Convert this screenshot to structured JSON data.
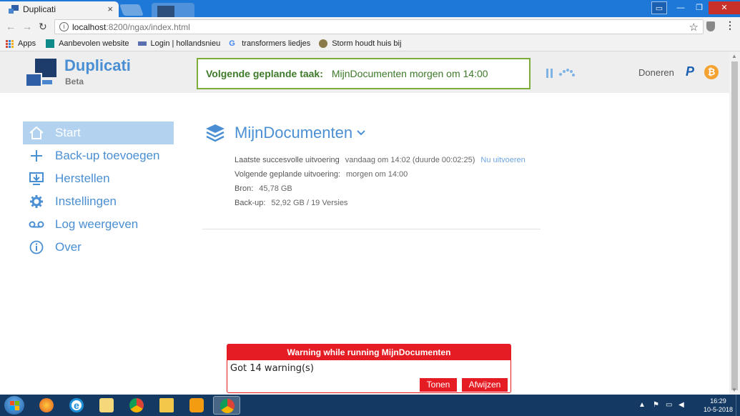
{
  "browser": {
    "tab_title": "Duplicati",
    "tab_close": "×",
    "url_host": "localhost",
    "url_rest": ":8200/ngax/index.html",
    "star": "☆",
    "menu": "⋮",
    "nav_back": "←",
    "nav_forward": "→",
    "reload": "↻",
    "window_controls": {
      "minimize": "—",
      "maximize": "❐",
      "close": "✕"
    }
  },
  "bookmarks": [
    {
      "label": "Apps",
      "icon": "apps-grid-icon"
    },
    {
      "label": "Aanbevolen website",
      "icon": "bing-icon",
      "color": "#0e8a8a"
    },
    {
      "label": "Login | hollandsnieu",
      "icon": "site-icon",
      "color": "#5a6fb0"
    },
    {
      "label": "transformers liedjes",
      "icon": "google-icon",
      "color": "#4285f4"
    },
    {
      "label": "Storm houdt huis bij",
      "icon": "gear-site-icon",
      "color": "#8a7a4a"
    }
  ],
  "header": {
    "brand": "Duplicati",
    "brand_sub": "Beta",
    "next_task_label": "Volgende geplande taak:",
    "next_task_value": "MijnDocumenten morgen om 14:00",
    "donate": "Doneren",
    "paypal": "P",
    "bitcoin": "₿"
  },
  "sidebar": {
    "items": [
      {
        "label": "Start",
        "icon": "home-icon",
        "active": true
      },
      {
        "label": "Back-up toevoegen",
        "icon": "plus-icon"
      },
      {
        "label": "Herstellen",
        "icon": "restore-icon"
      },
      {
        "label": "Instellingen",
        "icon": "gear-icon"
      },
      {
        "label": "Log weergeven",
        "icon": "log-icon"
      },
      {
        "label": "Over",
        "icon": "info-icon"
      }
    ]
  },
  "backup": {
    "name": "MijnDocumenten",
    "last_run_label": "Laatste succesvolle uitvoering",
    "last_run_value": "vandaag om 14:02 (duurde 00:02:25)",
    "run_now": "Nu uitvoeren",
    "next_run_label": "Volgende geplande uitvoering:",
    "next_run_value": "morgen om 14:00",
    "source_label": "Bron:",
    "source_value": "45,78 GB",
    "backup_label": "Back-up:",
    "backup_value": "52,92 GB / 19 Versies"
  },
  "warning": {
    "title": "Warning while running MijnDocumenten",
    "message": "Got 14 warning(s)",
    "show_button": "Tonen",
    "dismiss_button": "Afwijzen"
  },
  "taskbar": {
    "time": "16:29",
    "date": "10-5-2018"
  },
  "colors": {
    "accent": "#4a8fd4",
    "task_green": "#3e7a2a",
    "warning_red": "#e51c23",
    "sidebar_active": "#b2d2ef"
  }
}
